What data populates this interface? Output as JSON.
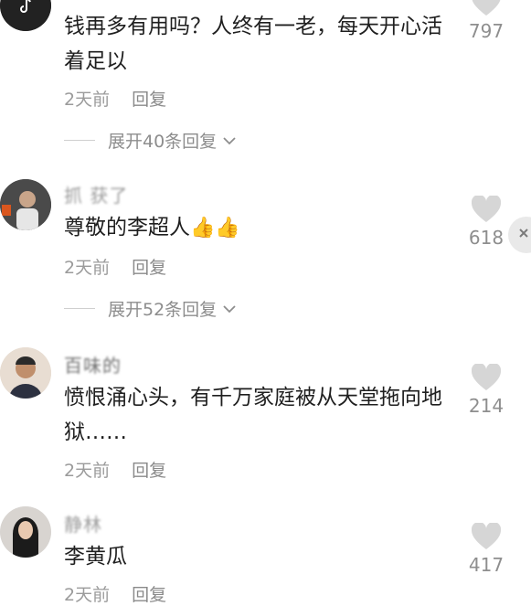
{
  "comments": [
    {
      "username": "",
      "text": "钱再多有用吗？人终有一老，每天开心活着足以",
      "time": "2天前",
      "reply": "回复",
      "expand": "展开40条回复",
      "likes": "797"
    },
    {
      "username": "抓   获了",
      "text": "尊敬的李超人",
      "emoji": "👍👍",
      "time": "2天前",
      "reply": "回复",
      "expand": "展开52条回复",
      "likes": "618"
    },
    {
      "username": "百味的",
      "text": "愤恨涌心头，有千万家庭被从天堂拖向地狱……",
      "time": "2天前",
      "reply": "回复",
      "likes": "214"
    },
    {
      "username": "静林",
      "text": "李黄瓜",
      "time": "2天前",
      "reply": "回复",
      "likes": "417"
    }
  ],
  "icons": {
    "like": "heart-icon",
    "expand": "chevron-down-icon",
    "close": "close-icon"
  },
  "colors": {
    "text": "#1f1f1f",
    "meta": "#9b9b9b",
    "heart": "#d6d6d6"
  }
}
